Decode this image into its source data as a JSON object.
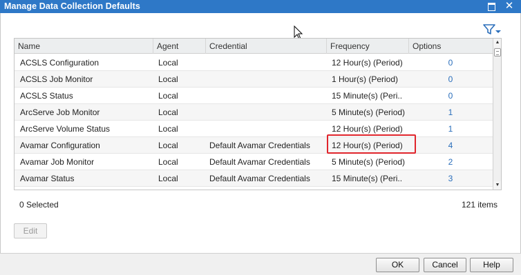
{
  "window": {
    "title": "Manage Data Collection Defaults"
  },
  "grid": {
    "columns": [
      "Name",
      "Agent",
      "Credential",
      "Frequency",
      "Options"
    ],
    "rows": [
      {
        "name": "ACSLS Configuration",
        "agent": "Local",
        "credential": "",
        "frequency": "12 Hour(s) (Period)",
        "options": "0"
      },
      {
        "name": "ACSLS Job Monitor",
        "agent": "Local",
        "credential": "",
        "frequency": "1 Hour(s) (Period)",
        "options": "0"
      },
      {
        "name": "ACSLS Status",
        "agent": "Local",
        "credential": "",
        "frequency": "15 Minute(s) (Peri..",
        "options": "0"
      },
      {
        "name": "ArcServe Job Monitor",
        "agent": "Local",
        "credential": "",
        "frequency": "5 Minute(s) (Period)",
        "options": "1"
      },
      {
        "name": "ArcServe Volume Status",
        "agent": "Local",
        "credential": "",
        "frequency": "12 Hour(s) (Period)",
        "options": "1"
      },
      {
        "name": "Avamar Configuration",
        "agent": "Local",
        "credential": "Default Avamar Credentials",
        "frequency": "12 Hour(s) (Period)",
        "options": "4"
      },
      {
        "name": "Avamar Job Monitor",
        "agent": "Local",
        "credential": "Default Avamar Credentials",
        "frequency": "5 Minute(s) (Period)",
        "options": "2"
      },
      {
        "name": "Avamar Status",
        "agent": "Local",
        "credential": "Default Avamar Credentials",
        "frequency": "15 Minute(s) (Peri..",
        "options": "3"
      }
    ]
  },
  "footer": {
    "selected": "0 Selected",
    "items": "121 items",
    "edit_label": "Edit"
  },
  "buttons": {
    "ok": "OK",
    "cancel": "Cancel",
    "help": "Help"
  },
  "colors": {
    "titlebar": "#2e78c7",
    "link": "#2a6ebb",
    "highlight": "#e0242b"
  },
  "icons": {
    "filter": "filter-icon",
    "maximize": "maximize-icon",
    "close": "close-icon"
  }
}
